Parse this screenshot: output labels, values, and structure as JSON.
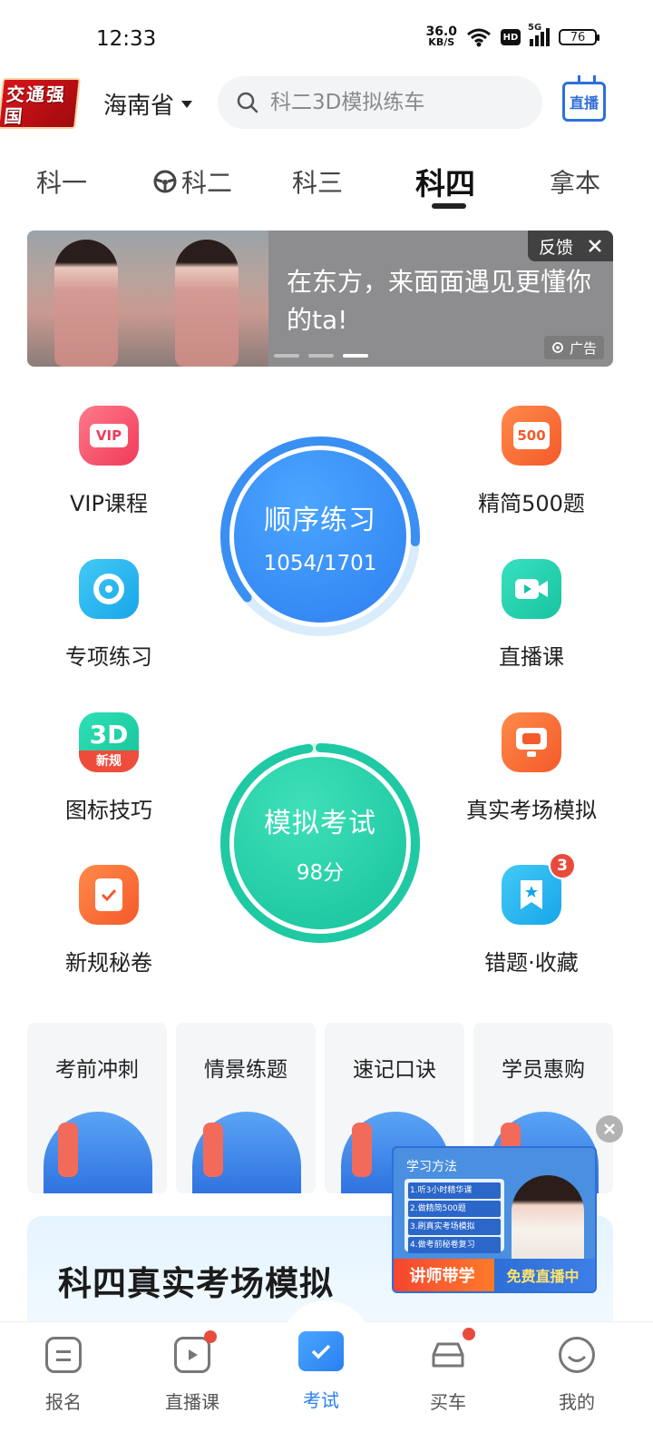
{
  "status_bar": {
    "time": "12:33",
    "net_speed_value": "36.0",
    "net_speed_unit": "KB/S",
    "hd_label": "HD",
    "signal_label": "5G",
    "battery": "76"
  },
  "header": {
    "logo_text": "交通强国",
    "province": "海南省",
    "search_placeholder": "科二3D模拟练车",
    "live_label": "直播"
  },
  "tabs": [
    {
      "label": "科一"
    },
    {
      "label": "科二"
    },
    {
      "label": "科三"
    },
    {
      "label": "科四"
    },
    {
      "label": "拿本"
    }
  ],
  "banner": {
    "text": "在东方，来面面遇见更懂你的ta!",
    "feedback": "反馈",
    "ad_label": "广告"
  },
  "features": {
    "vip": "VIP课程",
    "vip_icon_text": "VIP",
    "special": "专项练习",
    "icons": "图标技巧",
    "icons_badge": "新规",
    "secret": "新规秘卷",
    "jingjian": "精简500题",
    "jingjian_icon_text": "500",
    "live_course": "直播课",
    "real_exam": "真实考场模拟",
    "mistakes": "错题·收藏",
    "mistakes_badge": "3"
  },
  "practice": {
    "title": "顺序练习",
    "progress": "1054/1701",
    "fraction": 0.62
  },
  "mock": {
    "title": "模拟考试",
    "score": "98分",
    "fraction": 0.98
  },
  "promos": [
    {
      "label": "考前冲刺"
    },
    {
      "label": "情景练题"
    },
    {
      "label": "速记口诀"
    },
    {
      "label": "学员惠购"
    }
  ],
  "video_ad": {
    "title": "学习方法",
    "steps": [
      "1.听3小时精华课",
      "2.做精简500题",
      "3.刷真实考场模拟",
      "4.做考前秘卷复习"
    ],
    "left_tag": "讲师带学",
    "right_tag": "免费直播中"
  },
  "exam_card": {
    "title": "科四真实考场模拟"
  },
  "bottom_nav": [
    {
      "label": "报名"
    },
    {
      "label": "直播课"
    },
    {
      "label": "考试"
    },
    {
      "label": "买车"
    },
    {
      "label": "我的"
    }
  ],
  "colors": {
    "accent": "#2a7ff0",
    "practice_blue": "#3a8ff2",
    "mock_green": "#1fc9a4",
    "badge_red": "#e84b3c"
  }
}
